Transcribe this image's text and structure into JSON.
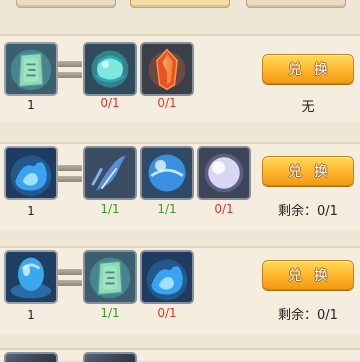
{
  "recipes": [
    {
      "result": {
        "icon": "jade-tablet-icon",
        "count": "1"
      },
      "materials": [
        {
          "icon": "cyan-orb-icon",
          "count": "0/1",
          "status": "red"
        },
        {
          "icon": "red-crystal-icon",
          "count": "0/1",
          "status": "red"
        }
      ],
      "button_label": "兑换",
      "status_text": "无"
    },
    {
      "result": {
        "icon": "blue-flame-icon",
        "count": "1"
      },
      "materials": [
        {
          "icon": "blue-feather-icon",
          "count": "1/1",
          "status": "green"
        },
        {
          "icon": "blue-sphere-icon",
          "count": "1/1",
          "status": "green"
        },
        {
          "icon": "silver-pearl-icon",
          "count": "0/1",
          "status": "red"
        }
      ],
      "button_label": "兑换",
      "status_text": "剩余：0/1"
    },
    {
      "result": {
        "icon": "blue-egg-icon",
        "count": "1"
      },
      "materials": [
        {
          "icon": "jade-tablet-icon",
          "count": "1/1",
          "status": "green"
        },
        {
          "icon": "blue-flame-icon",
          "count": "0/1",
          "status": "red"
        }
      ],
      "button_label": "兑换",
      "status_text": "剩余：0/1"
    }
  ],
  "colors": {
    "red": "#d23a28",
    "green": "#3a9a2a",
    "button": "#ffb52a"
  }
}
